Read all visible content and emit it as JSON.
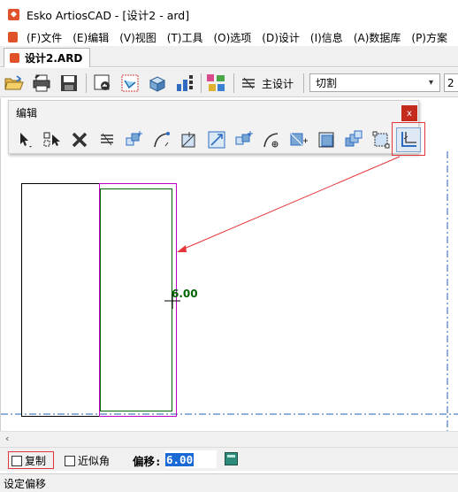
{
  "window": {
    "title": "Esko ArtiosCAD - [设计2 - ard]",
    "app_icon": "artioscad-logo-icon"
  },
  "menu": {
    "items": [
      {
        "label": "(F)文件"
      },
      {
        "label": "(E)编辑"
      },
      {
        "label": "(V)视图"
      },
      {
        "label": "(T)工具"
      },
      {
        "label": "(O)选项"
      },
      {
        "label": "(D)设计"
      },
      {
        "label": "(I)信息"
      },
      {
        "label": "(A)数据库"
      },
      {
        "label": "(P)方案"
      }
    ]
  },
  "tabs": {
    "active": "设计2.ARD"
  },
  "toolbar": {
    "icons": [
      "open-folder-icon",
      "print-icon",
      "save-icon",
      "back-icon",
      "view-icon",
      "3d-box-icon",
      "step-icon",
      "layers-icon"
    ],
    "main_design_label": "主设计",
    "layer_value": "切割",
    "zoom_value": "2"
  },
  "palette": {
    "title": "编辑",
    "close": "x",
    "tools": [
      "select-icon",
      "select-multiple-icon",
      "delete-icon",
      "stack-icon",
      "move-icon",
      "arc-icon",
      "scale-icon",
      "stretch-icon",
      "duplicate-icon",
      "rotate-icon",
      "mirror-icon",
      "group-icon",
      "copy-layers-icon",
      "transform-icon",
      "offset-line-icon"
    ]
  },
  "drawing": {
    "dimension_text": "6.00"
  },
  "options": {
    "copy_label": "复制",
    "approx_angle_label": "近似角",
    "offset_label": "偏移:",
    "offset_value": "6.00"
  },
  "status": {
    "text": "设定偏移"
  },
  "colors": {
    "accent_red": "#e5353a",
    "offset_green": "#006400",
    "outline_magenta": "#c000c0",
    "guide_blue": "#2060b0",
    "selection_blue": "#1a6ad6"
  }
}
